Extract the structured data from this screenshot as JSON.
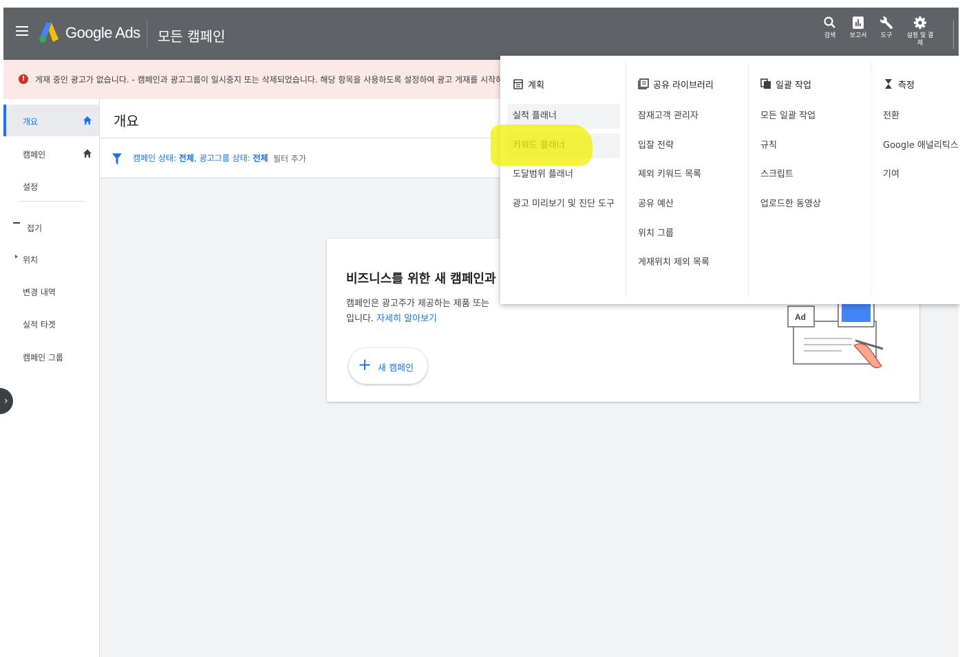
{
  "header": {
    "brand": "Google Ads",
    "page_name": "모든 캠페인",
    "actions": [
      {
        "label": "검색",
        "icon": "search-icon"
      },
      {
        "label": "보고서",
        "icon": "report-icon"
      },
      {
        "label": "도구",
        "icon": "wrench-icon"
      },
      {
        "label": "설정 및 결제",
        "icon": "gear-icon"
      }
    ]
  },
  "alert": {
    "text": "게재 중인 광고가 없습니다. - 캠페인과 광고그룹이 일시중지 또는 삭제되었습니다. 해당 항목을 사용하도록 설정하여 광고 게재를 시작하"
  },
  "sidebar": {
    "items": [
      {
        "label": "개요"
      },
      {
        "label": "캠페인"
      },
      {
        "label": "설정"
      },
      {
        "label": "접기"
      },
      {
        "label": "위치"
      },
      {
        "label": "변경 내역"
      },
      {
        "label": "실적 타겟"
      },
      {
        "label": "캠페인 그룹"
      }
    ]
  },
  "main": {
    "title": "개요",
    "filter": {
      "prefix1": "캠페인 상태: ",
      "value1": "전체",
      "prefix2": ", 광고그룹 상태: ",
      "value2": "전체",
      "add": "필터 추가"
    },
    "card": {
      "title": "비즈니스를 위한 새 캠페인과",
      "desc1": "캠페인은 광고주가 제공하는 제품 또는",
      "desc2": "입니다.",
      "learn_more": "자세히 알아보기",
      "new_campaign": "새 캠페인",
      "ad_badge": "Ad"
    }
  },
  "tools_menu": {
    "columns": [
      {
        "title": "계획",
        "items": [
          "실적 플래너",
          "키워드 플래너",
          "도달범위 플래너",
          "광고 미리보기 및 진단 도구"
        ]
      },
      {
        "title": "공유 라이브러리",
        "items": [
          "잠재고객 관리자",
          "입찰 전략",
          "제외 키워드 목록",
          "공유 예산",
          "위치 그룹",
          "게재위치 제외 목록"
        ]
      },
      {
        "title": "일괄 작업",
        "items": [
          "모든 일괄 작업",
          "규칙",
          "스크립트",
          "업로드한 동영상"
        ]
      },
      {
        "title": "측정",
        "items": [
          "전환",
          "Google 애널리틱스",
          "기여"
        ]
      }
    ]
  },
  "colors": {
    "header_bg": "#5f6368",
    "accent": "#1a73e8",
    "alert_bg": "#fce8e6",
    "alert_icon": "#d93025",
    "highlight_marker": "#f0f000"
  }
}
